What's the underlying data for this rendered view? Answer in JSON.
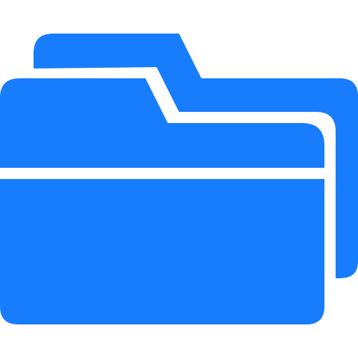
{
  "icon": {
    "name": "folders-icon",
    "color": "#177dfd",
    "background": "#ffffff"
  }
}
